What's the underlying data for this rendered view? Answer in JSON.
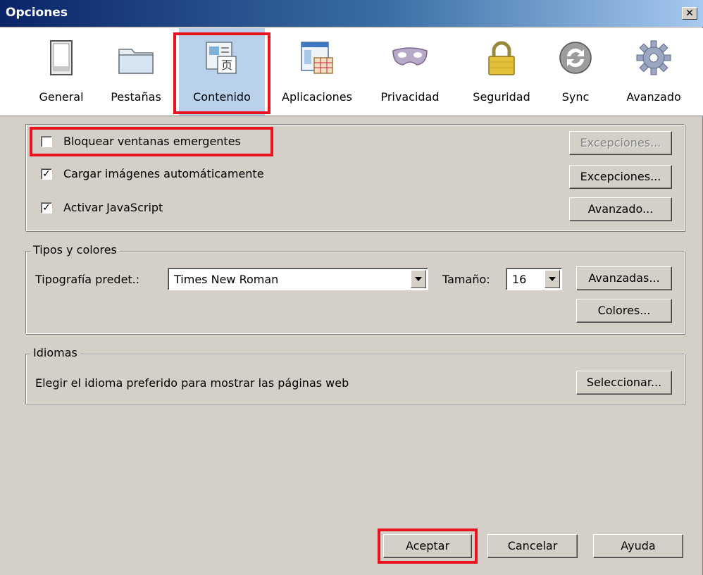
{
  "window": {
    "title": "Opciones",
    "close_label": "✕"
  },
  "tabs": [
    {
      "label": "General",
      "icon": "general-window-icon"
    },
    {
      "label": "Pestañas",
      "icon": "tabs-folder-icon"
    },
    {
      "label": "Contenido",
      "icon": "content-icon"
    },
    {
      "label": "Aplicaciones",
      "icon": "applications-icon"
    },
    {
      "label": "Privacidad",
      "icon": "privacy-mask-icon"
    },
    {
      "label": "Seguridad",
      "icon": "security-lock-icon"
    },
    {
      "label": "Sync",
      "icon": "sync-icon"
    },
    {
      "label": "Avanzado",
      "icon": "gear-icon"
    }
  ],
  "selected_tab": "Contenido",
  "content": {
    "block_popups": {
      "label": "Bloquear ventanas emergentes",
      "checked": false,
      "exceptions_label": "Excepciones..."
    },
    "load_images": {
      "label": "Cargar imágenes automáticamente",
      "checked": true,
      "exceptions_label": "Excepciones..."
    },
    "javascript": {
      "label": "Activar JavaScript",
      "checked": true,
      "advanced_label": "Avanzado..."
    }
  },
  "fonts": {
    "legend": "Tipos y colores",
    "default_font_label": "Tipografía predet.:",
    "default_font_value": "Times New Roman",
    "size_label": "Tamaño:",
    "size_value": "16",
    "advanced_label": "Avanzadas...",
    "colors_label": "Colores..."
  },
  "languages": {
    "legend": "Idiomas",
    "description": "Elegir el idioma preferido para mostrar las páginas web",
    "select_label": "Seleccionar..."
  },
  "footer": {
    "accept_label": "Aceptar",
    "cancel_label": "Cancelar",
    "help_label": "Ayuda"
  },
  "colors": {
    "highlight": "#e8131f",
    "selected_tab": "#b9d1ea",
    "dialog_bg": "#d4d0c8"
  }
}
